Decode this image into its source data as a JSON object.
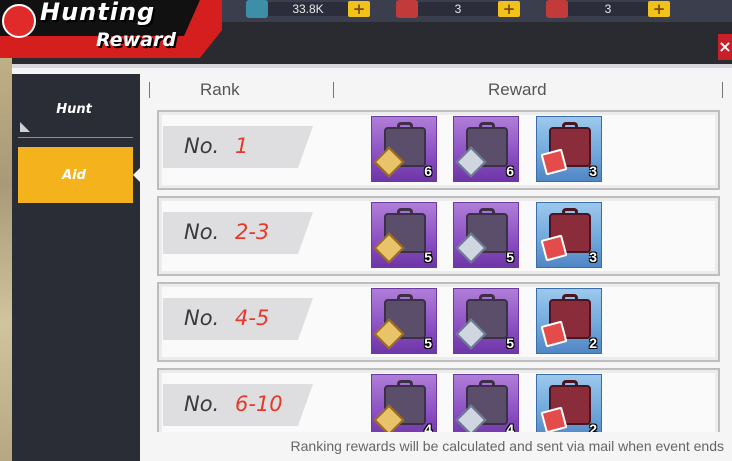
{
  "title": {
    "line1": "Hunting",
    "line2": "Reward"
  },
  "currencies": [
    {
      "icon": "gem-icon",
      "value": "33.8K"
    },
    {
      "icon": "ticket-icon",
      "value": "3"
    },
    {
      "icon": "ticket-icon",
      "value": "3"
    }
  ],
  "sidebar": {
    "tabs": [
      {
        "label": "Hunt",
        "active": false
      },
      {
        "label": "Aid",
        "active": true
      }
    ]
  },
  "table": {
    "headers": {
      "rank": "Rank",
      "reward": "Reward"
    },
    "rows": [
      {
        "prefix": "No.",
        "rank": "1",
        "rewards": [
          {
            "type": "gold-gear-case",
            "qty": "6"
          },
          {
            "type": "silver-gear-case",
            "qty": "6"
          },
          {
            "type": "ticket-case",
            "qty": "3"
          }
        ]
      },
      {
        "prefix": "No.",
        "rank": "2-3",
        "rewards": [
          {
            "type": "gold-gear-case",
            "qty": "5"
          },
          {
            "type": "silver-gear-case",
            "qty": "5"
          },
          {
            "type": "ticket-case",
            "qty": "3"
          }
        ]
      },
      {
        "prefix": "No.",
        "rank": "4-5",
        "rewards": [
          {
            "type": "gold-gear-case",
            "qty": "5"
          },
          {
            "type": "silver-gear-case",
            "qty": "5"
          },
          {
            "type": "ticket-case",
            "qty": "2"
          }
        ]
      },
      {
        "prefix": "No.",
        "rank": "6-10",
        "rewards": [
          {
            "type": "gold-gear-case",
            "qty": "4"
          },
          {
            "type": "silver-gear-case",
            "qty": "4"
          },
          {
            "type": "ticket-case",
            "qty": "2"
          }
        ]
      }
    ]
  },
  "footer": "Ranking rewards will be calculated and sent via mail when event ends",
  "colors": {
    "accent": "#f4b21c",
    "banner": "#d51f1f",
    "rank_number": "#e33a2a"
  }
}
